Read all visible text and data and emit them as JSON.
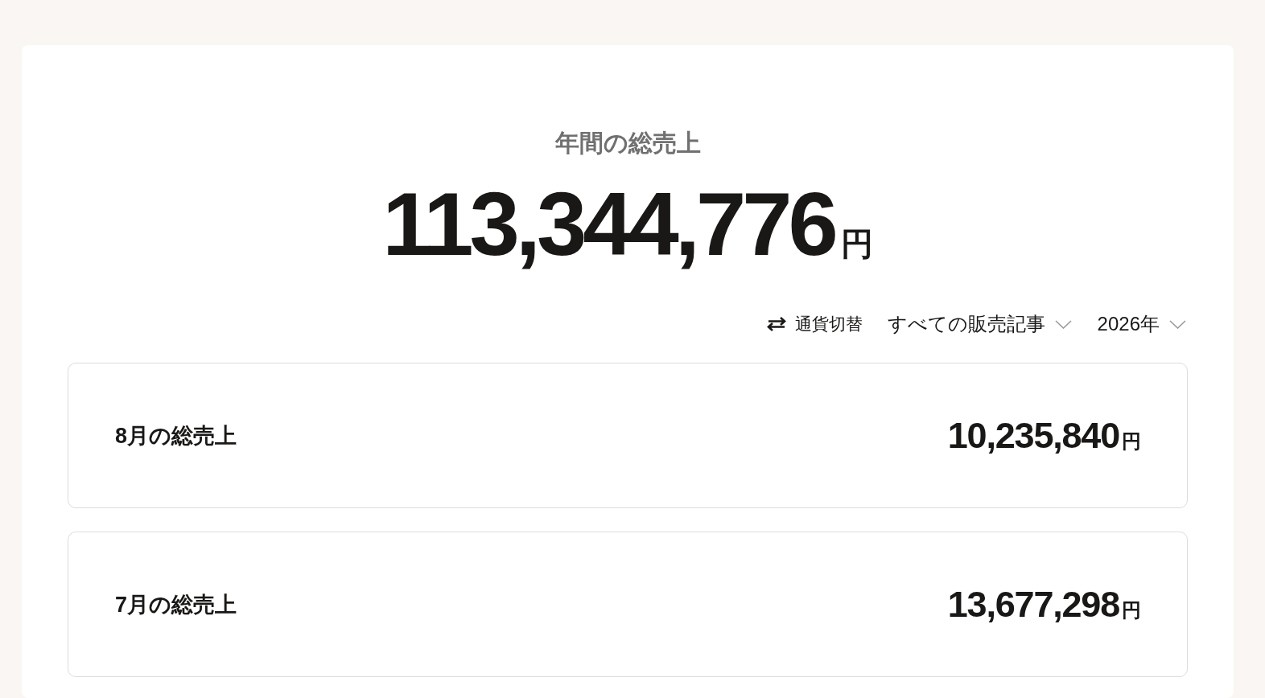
{
  "header": {
    "title": "年間の総売上",
    "total": "113,344,776",
    "unit": "円"
  },
  "controls": {
    "currency_switch": "通貨切替",
    "article_filter": "すべての販売記事",
    "year_filter": "2026年"
  },
  "months": [
    {
      "label": "8月の総売上",
      "amount": "10,235,840",
      "unit": "円"
    },
    {
      "label": "7月の総売上",
      "amount": "13,677,298",
      "unit": "円"
    }
  ]
}
